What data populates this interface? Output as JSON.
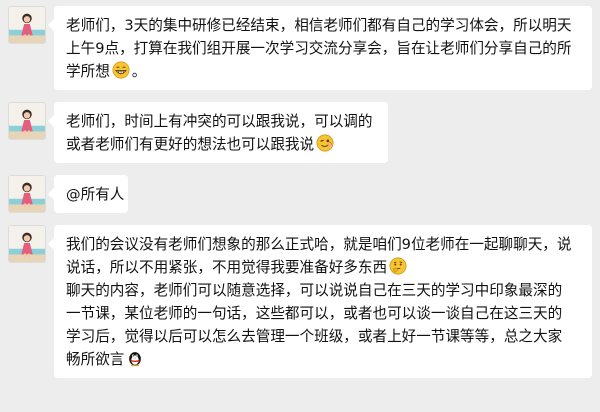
{
  "messages": [
    {
      "lines": [
        "老师们，3天的集中研修已经结束，相信老师们都有自己的学习体会，所以明天",
        "上午9点，打算在我们组开展一次学习交流分享会，旨在让老师们分享自己的所",
        "学所想"
      ],
      "end_emoji": "grin-emoji",
      "after_emoji": "。"
    },
    {
      "lines": [
        "老师们，时间上有冲突的可以跟我说，可以调的",
        "或者老师们有更好的想法也可以跟我说"
      ],
      "end_emoji": "wink-emoji"
    },
    {
      "lines": [
        "@所有人"
      ]
    },
    {
      "lines": [
        "我们的会议没有老师们想象的那么正式哈，就是咱们9位老师在一起聊聊天，说",
        "说话，所以不用紧张，不用觉得我要准备好多东西",
        "聊天的内容，老师们可以随意选择，可以说说自己在三天的学习中印象最深的",
        "一节课，某位老师的一句话，这些都可以，或者也可以谈一谈自己在这三天的",
        "学习后，觉得以后可以怎么去管理一个班级，或者上好一节课等等，总之大家",
        "畅所欲言"
      ],
      "emojis": [
        "thinking-emoji",
        "penguin-emoji"
      ]
    }
  ]
}
